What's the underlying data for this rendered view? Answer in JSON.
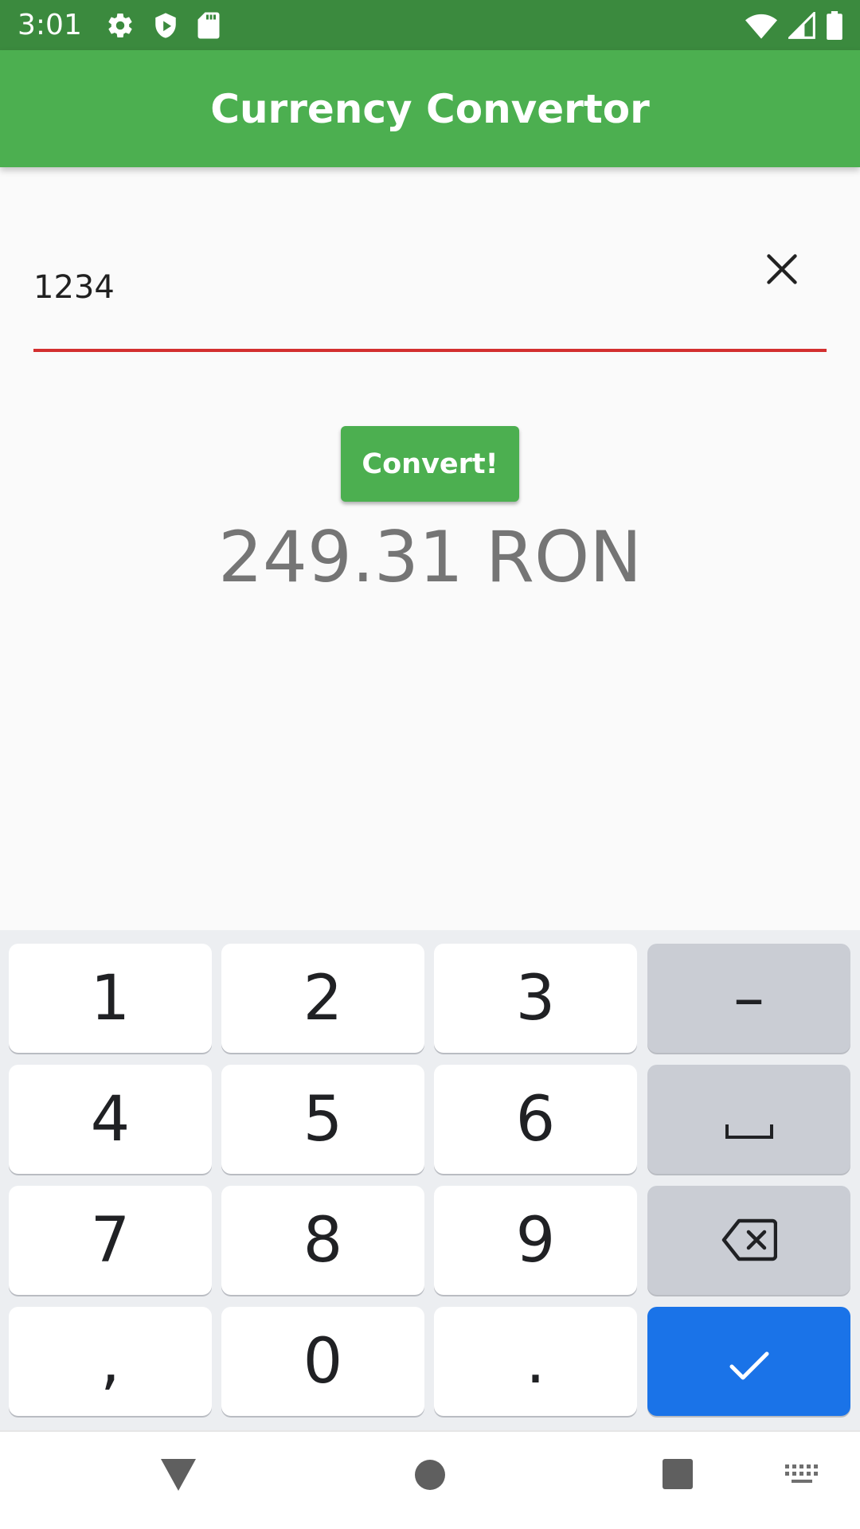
{
  "status_bar": {
    "time": "3:01",
    "icons": [
      "gear-icon",
      "shield-icon",
      "sd-card-icon",
      "wifi-icon",
      "signal-icon",
      "battery-icon"
    ]
  },
  "app_bar": {
    "title": "Currency Convertor"
  },
  "input": {
    "value": "1234",
    "clear_icon": "close-icon",
    "underline_color": "#d32f2f"
  },
  "convert_button": {
    "label": "Convert!"
  },
  "result": {
    "text": "249.31 RON"
  },
  "keyboard": {
    "keys": [
      "1",
      "2",
      "3",
      "–",
      "4",
      "5",
      "6",
      "space",
      "7",
      "8",
      "9",
      "backspace",
      ",",
      "0",
      ".",
      "done"
    ],
    "enter_color": "#1a73e8"
  },
  "nav_bar": {
    "icons": [
      "back-icon",
      "home-icon",
      "recents-icon",
      "keyboard-icon"
    ]
  },
  "colors": {
    "primary": "#4caf50",
    "status_bar": "#3b8a3e"
  }
}
